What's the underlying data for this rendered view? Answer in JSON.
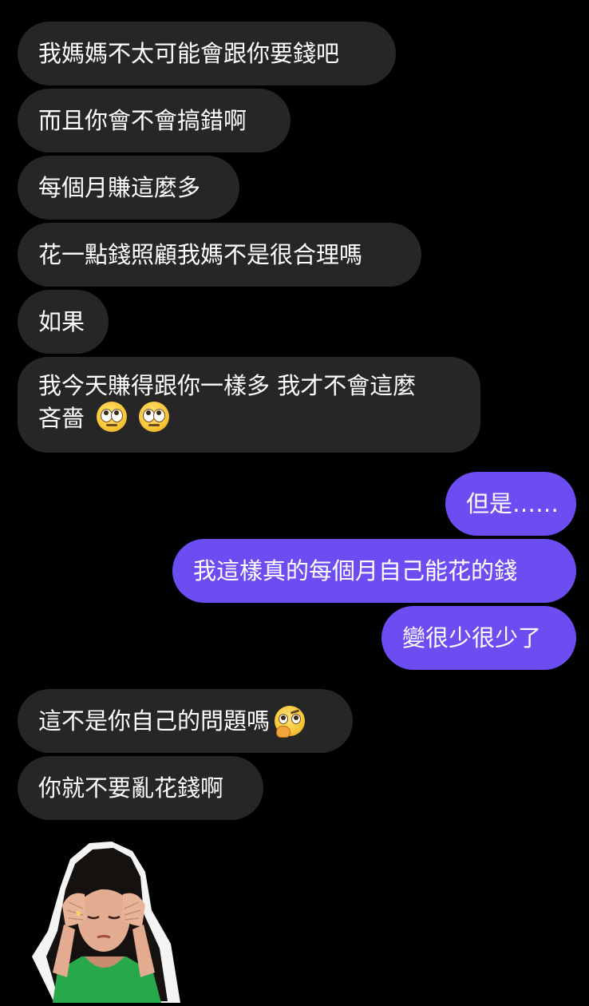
{
  "theme": {
    "background": "#000000",
    "incoming_bubble": "#262626",
    "outgoing_bubble": "#6c4df2",
    "text": "#ffffff"
  },
  "messages": [
    {
      "side": "in",
      "text": "我媽媽不太可能會跟你要錢吧"
    },
    {
      "side": "in",
      "text": "而且你會不會搞錯啊"
    },
    {
      "side": "in",
      "text": "每個月賺這麼多"
    },
    {
      "side": "in",
      "text": "花一點錢照顧我媽不是很合理嗎"
    },
    {
      "side": "in",
      "text": "如果"
    },
    {
      "side": "in",
      "line1": "我今天賺得跟你一樣多 我才不會這麼",
      "line2": "吝嗇",
      "emojis": [
        "eye-roll-emoji",
        "eye-roll-emoji"
      ]
    },
    {
      "side": "out",
      "text": "但是……"
    },
    {
      "side": "out",
      "text": "我這樣真的每個月自己能花的錢"
    },
    {
      "side": "out",
      "text": "變很少很少了"
    },
    {
      "side": "in",
      "text": "這不是你自己的問題嗎",
      "emojis": [
        "thinking-face-emoji"
      ]
    },
    {
      "side": "in",
      "text": "你就不要亂花錢啊"
    }
  ],
  "sticker": {
    "icon": "sticker-woman-headache"
  }
}
